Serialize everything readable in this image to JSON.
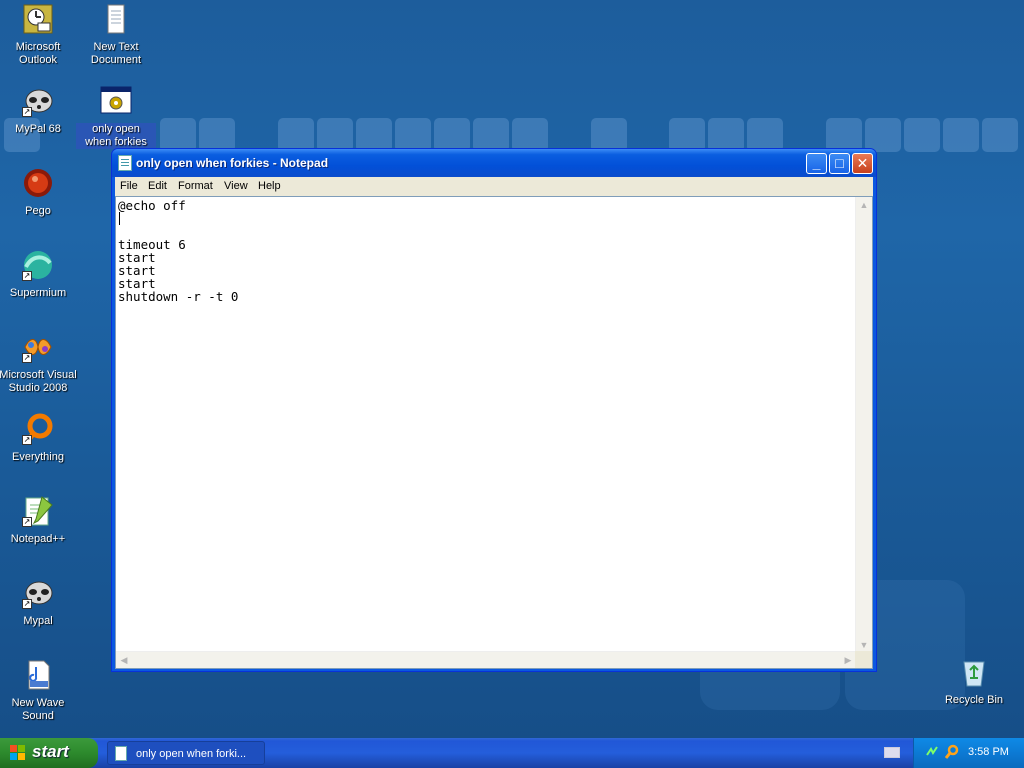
{
  "desktop": {
    "icons": [
      {
        "label": "Microsoft Outlook",
        "icon": "outlook-icon",
        "shortcut": false
      },
      {
        "label": "New Text Document",
        "icon": "text-document-icon",
        "shortcut": false
      },
      {
        "label": "MyPal 68",
        "icon": "mypal-icon",
        "shortcut": true
      },
      {
        "label": "only open when forkies",
        "icon": "batch-file-icon",
        "shortcut": false
      },
      {
        "label": "Pego",
        "icon": "pego-icon",
        "shortcut": false
      },
      {
        "label": "Supermium",
        "icon": "supermium-icon",
        "shortcut": true
      },
      {
        "label": "Microsoft Visual Studio 2008",
        "icon": "visual-studio-icon",
        "shortcut": true
      },
      {
        "label": "Everything",
        "icon": "everything-search-icon",
        "shortcut": true
      },
      {
        "label": "Notepad++",
        "icon": "notepadpp-icon",
        "shortcut": true
      },
      {
        "label": "Mypal",
        "icon": "mypal-icon",
        "shortcut": true
      },
      {
        "label": "New Wave Sound",
        "icon": "wave-sound-icon",
        "shortcut": false
      },
      {
        "label": "Recycle Bin",
        "icon": "recycle-bin-icon",
        "shortcut": false
      }
    ]
  },
  "window": {
    "title": "only open when forkies - Notepad",
    "buttons": {
      "minimize": "_",
      "maximize": "□",
      "close": "✕"
    },
    "menu": [
      "File",
      "Edit",
      "Format",
      "View",
      "Help"
    ],
    "content": "@echo off\n\n\ntimeout 6\nstart\nstart\nstart\nshutdown -r -t 0"
  },
  "taskbar": {
    "start_label": "start",
    "task_label": "only open when forki...",
    "clock": "3:58 PM"
  },
  "colors": {
    "desktop_blue": "#1f66a8",
    "titlebar_blue": "#0250d8",
    "start_green": "#2d8a2d",
    "close_red": "#c7401d"
  }
}
